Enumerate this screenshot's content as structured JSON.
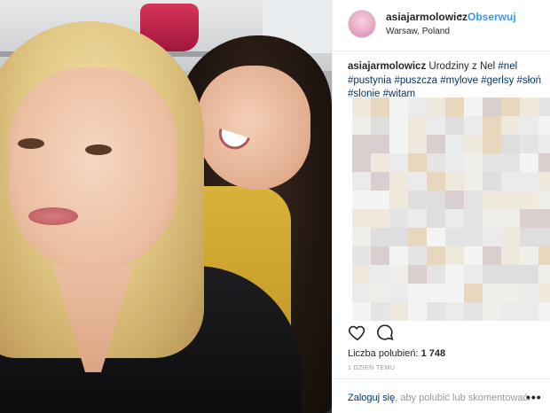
{
  "post": {
    "username": "asiajarmolowicz",
    "separator": "•",
    "follow_label": "Obserwuj",
    "location": "Warsaw, Poland"
  },
  "caption": {
    "author": "asiajarmolowicz",
    "text": "Urodziny z Nel",
    "hashtags": [
      "#nel",
      "#pustynia",
      "#puszcza",
      "#mylove",
      "#gerlsy",
      "#słoń",
      "#slonie",
      "#witam"
    ]
  },
  "actions": {
    "like_icon": "heart-icon",
    "comment_icon": "comment-icon"
  },
  "likes": {
    "label": "Liczba polubień:",
    "count": "1 748"
  },
  "time_ago": "1 DZIEŃ TEMU",
  "footer": {
    "login_link": "Zaloguj się",
    "login_rest": ", aby polubić lub skomentować.",
    "more_label": "•••"
  },
  "colors": {
    "link_blue": "#3897f0",
    "hashtag": "#003569",
    "muted": "#999999"
  }
}
